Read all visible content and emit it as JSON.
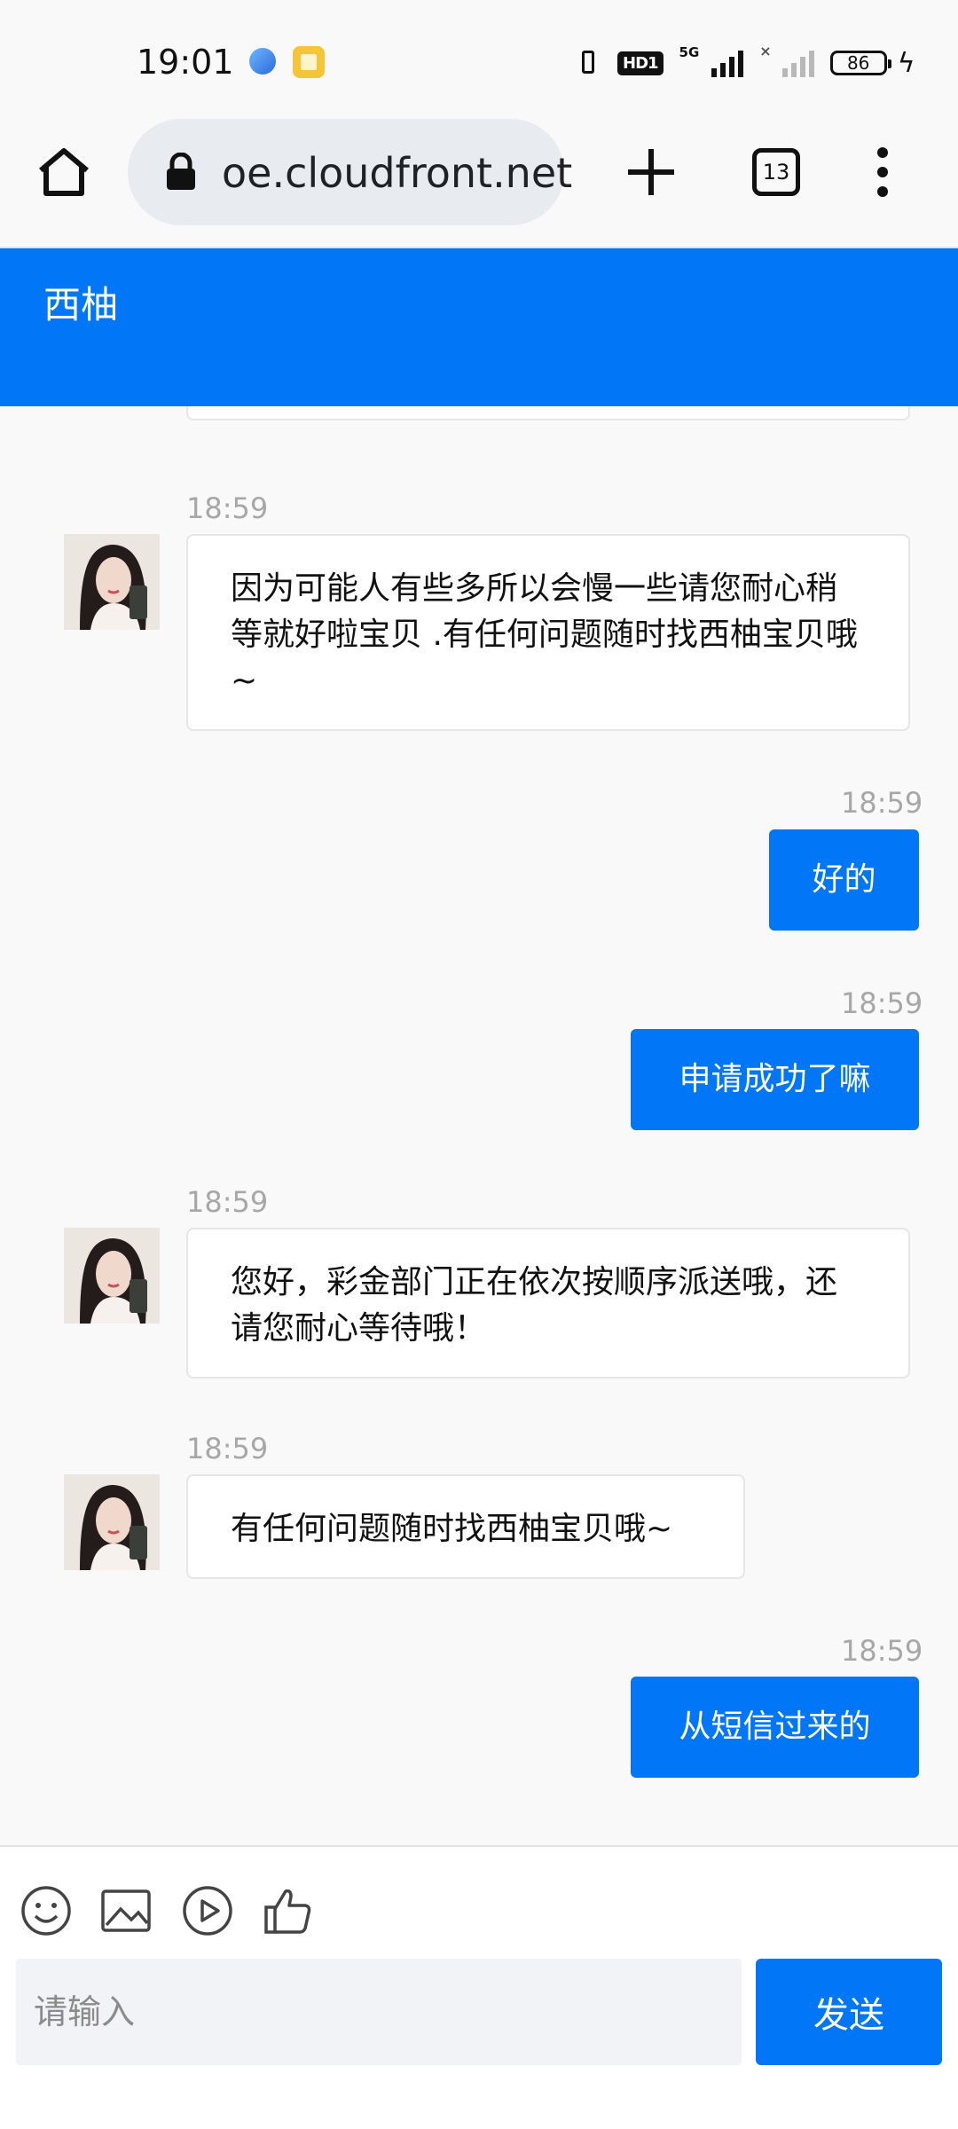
{
  "status_bar": {
    "time": "19:01",
    "network": "5G",
    "hd_badge": "HD1",
    "battery": "86",
    "icons": [
      "app-icon-blue",
      "app-icon-yellow",
      "vibrate-icon",
      "hd-icon",
      "signal-icon",
      "signal-icon",
      "battery-icon",
      "charging-icon"
    ]
  },
  "browser": {
    "url": "oe.cloudfront.net",
    "tab_count": "13",
    "icons": [
      "home-icon",
      "lock-icon",
      "plus-icon",
      "tabs-icon",
      "menu-icon"
    ]
  },
  "chat": {
    "title": "西柚",
    "messages": [
      {
        "side": "in",
        "time": "18:59",
        "text": "因为可能人有些多所以会慢一些请您耐心稍等就好啦宝贝 .有任何问题随时找西柚宝贝哦~"
      },
      {
        "side": "out",
        "time": "18:59",
        "text": "好的"
      },
      {
        "side": "out",
        "time": "18:59",
        "text": "申请成功了嘛"
      },
      {
        "side": "in",
        "time": "18:59",
        "text": "您好，彩金部门正在依次按顺序派送哦，还请您耐心等待哦！"
      },
      {
        "side": "in",
        "time": "18:59",
        "text": "有任何问题随时找西柚宝贝哦~"
      },
      {
        "side": "out",
        "time": "18:59",
        "text": "从短信过来的"
      }
    ]
  },
  "composer": {
    "placeholder": "请输入",
    "send_label": "发送",
    "tools": [
      "emoji-icon",
      "image-icon",
      "video-icon",
      "thumbs-up-icon"
    ]
  },
  "colors": {
    "accent": "#0176f7",
    "background": "#f9f9fa",
    "timestamp": "#a7a7a7"
  }
}
